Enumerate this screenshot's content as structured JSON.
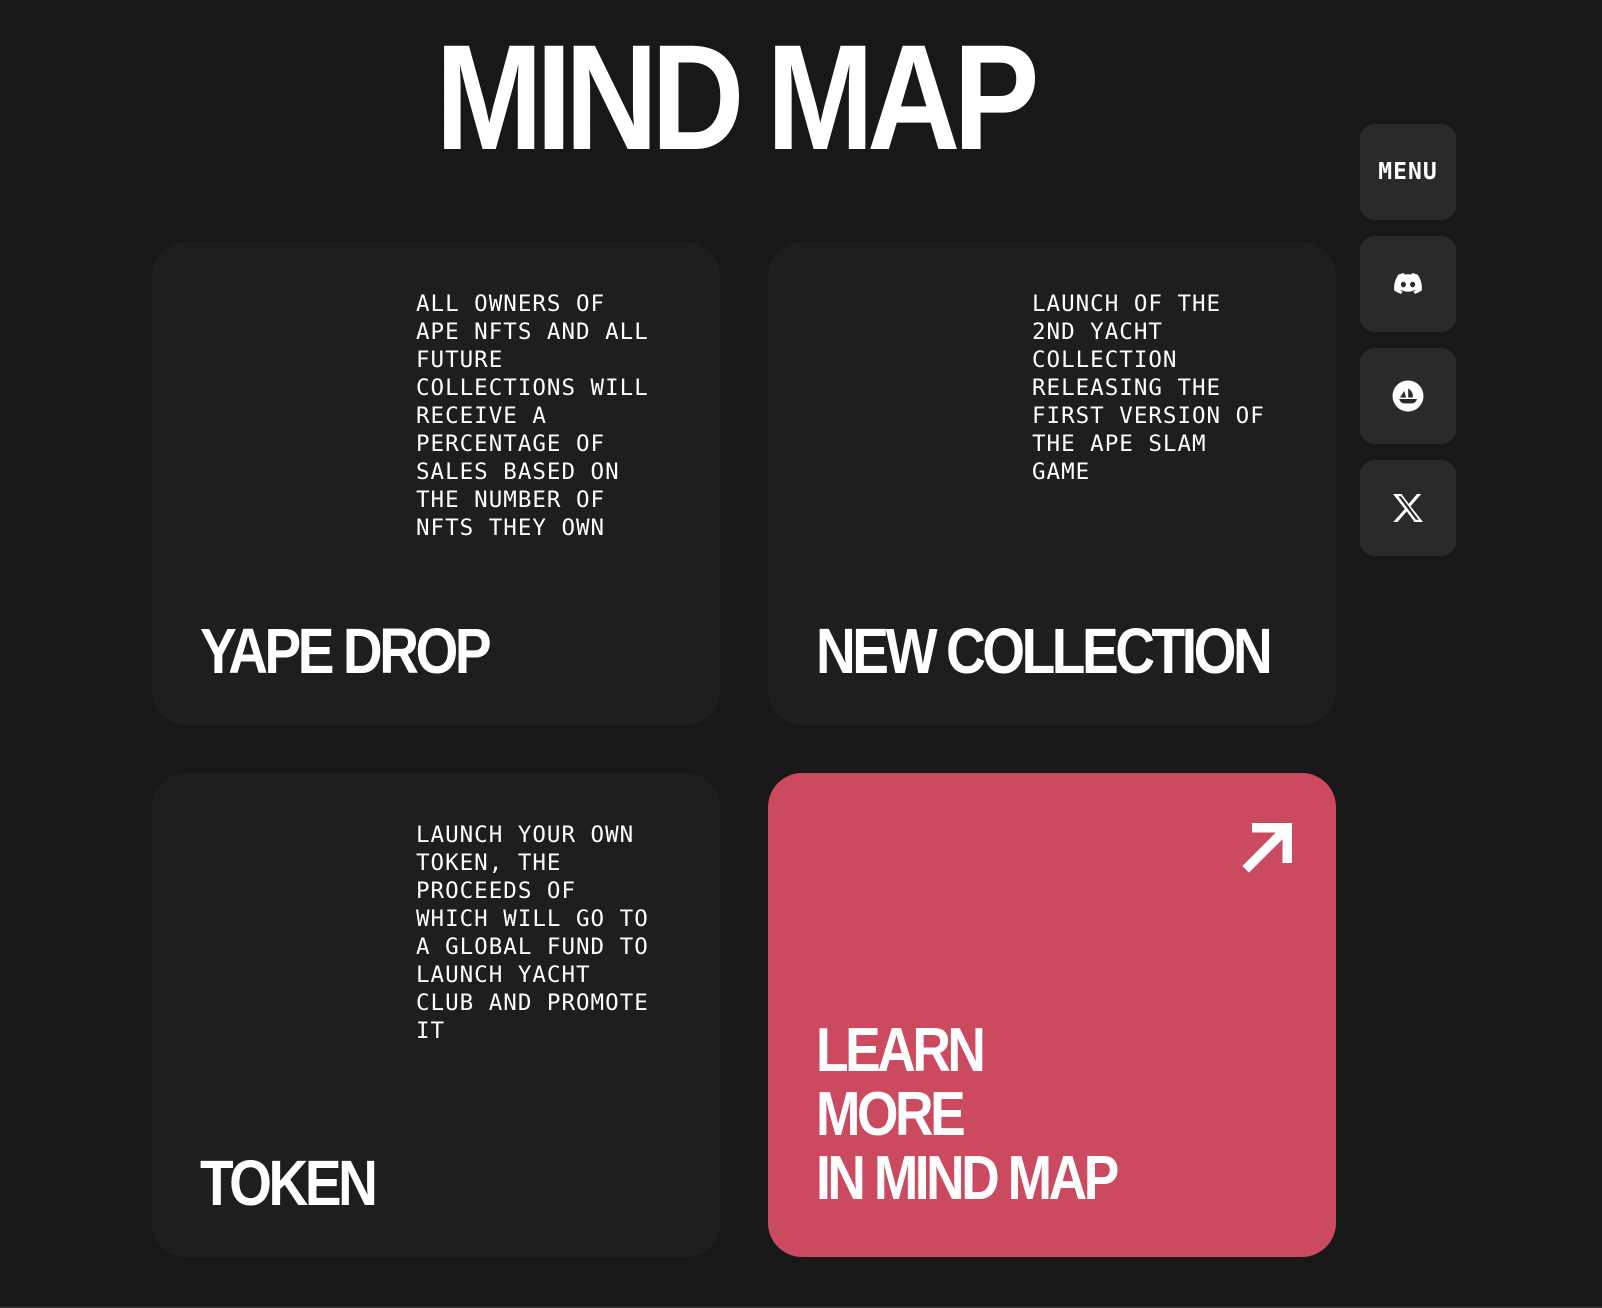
{
  "header": {
    "title": "MIND MAP"
  },
  "side_nav": {
    "menu_label": "MENU",
    "icons": [
      "discord-icon",
      "opensea-icon",
      "x-icon"
    ]
  },
  "cards": [
    {
      "description": "ALL OWNERS OF\nAPE NFTS AND ALL\nFUTURE\nCOLLECTIONS WILL\nRECEIVE A\nPERCENTAGE OF\nSALES BASED ON\nTHE NUMBER OF\nNFTS THEY OWN",
      "title": "YAPE DROP"
    },
    {
      "description": "LAUNCH OF THE\n2ND YACHT\nCOLLECTION\nRELEASING THE\nFIRST VERSION OF\nTHE APE SLAM\nGAME",
      "title": "NEW COLLECTION"
    },
    {
      "description": "LAUNCH YOUR OWN\nTOKEN, THE\nPROCEEDS OF\nWHICH WILL GO TO\nA GLOBAL FUND TO\nLAUNCH YACHT\nCLUB AND PROMOTE\nIT",
      "title": "TOKEN"
    }
  ],
  "cta": {
    "line1": "LEARN",
    "line2": "MORE",
    "line3": "IN MIND MAP",
    "icon": "arrow-up-right-icon",
    "color": "#cb4a5f"
  },
  "colors": {
    "background": "#181818",
    "card": "#1e1e1e",
    "button": "#2a2a2a",
    "text": "#ffffff"
  }
}
